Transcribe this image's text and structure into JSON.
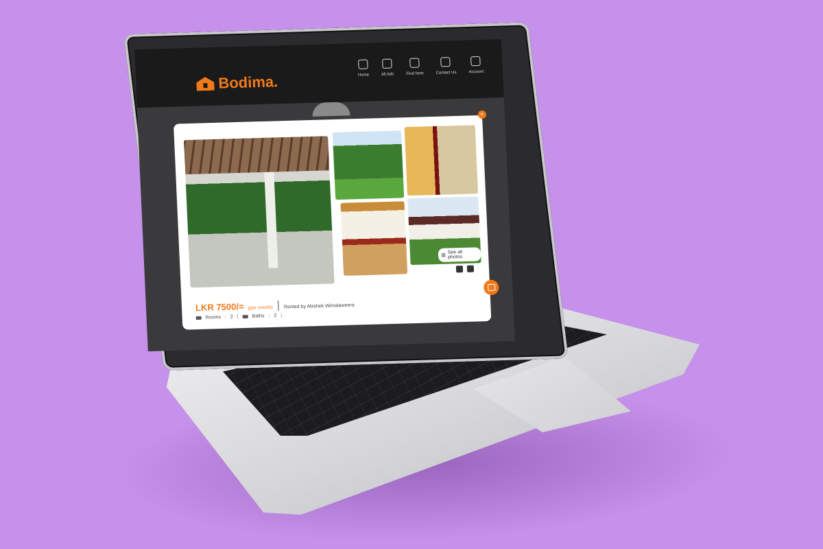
{
  "app": {
    "brand": "Bodima."
  },
  "nav": {
    "items": [
      {
        "label": "Home",
        "icon": "home-icon"
      },
      {
        "label": "All Ads",
        "icon": "target-icon"
      },
      {
        "label": "Find here",
        "icon": "search-icon"
      },
      {
        "label": "Contact Us",
        "icon": "headset-icon"
      },
      {
        "label": "Account",
        "icon": "user-icon"
      }
    ]
  },
  "modal": {
    "close_label": "×",
    "see_all_label": "See all photos",
    "price": "LKR 7500/=",
    "period": "(per month)",
    "rented_by": "Rented by Abishek Wimalaweera",
    "rooms_label": "Rooms",
    "rooms_value": "2",
    "baths_label": "Baths",
    "baths_value": "2"
  },
  "colors": {
    "accent": "#f07a1a",
    "background": "#c691ea",
    "topbar": "#1a1a1a"
  }
}
